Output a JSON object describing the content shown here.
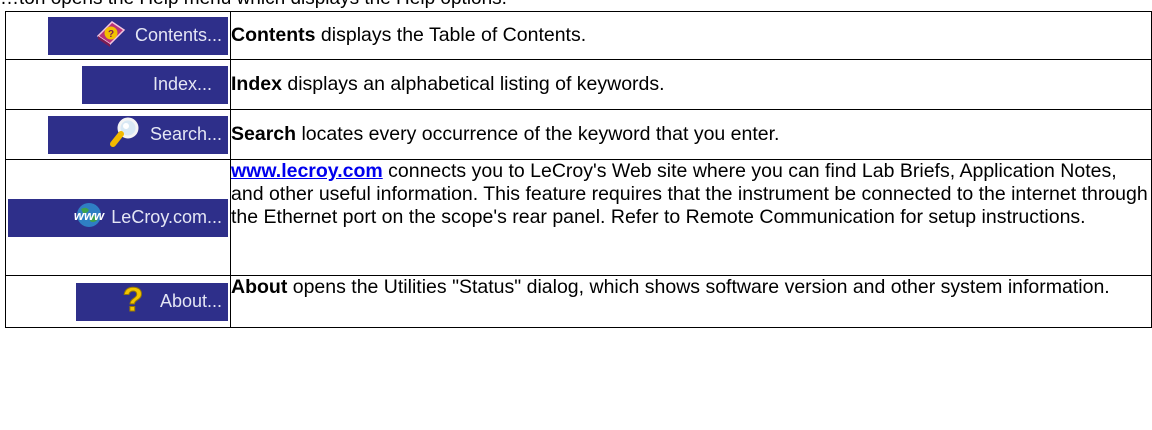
{
  "intro_text": "…ton opens the Help menu which displays the Help options.",
  "rows": [
    {
      "button_label": "Contents...",
      "icon": "book-question-icon",
      "term": "Contents",
      "text": " displays the Table of Contents."
    },
    {
      "button_label": "Index...",
      "icon": "",
      "term": "Index",
      "text": " displays an alphabetical listing of keywords."
    },
    {
      "button_label": "Search...",
      "icon": "magnifier-icon",
      "term": "Search",
      "text": " locates every occurrence of the keyword that you enter."
    },
    {
      "button_label": "LeCroy.com...",
      "icon": "www-globe-icon",
      "term": "www.lecroy.com",
      "text": " connects you to LeCroy's Web site where you can find Lab Briefs, Application Notes, and other useful information. This feature requires that the instrument be connected to the internet through the Ethernet port on the scope's rear panel. Refer to Remote Communication for setup instructions."
    },
    {
      "button_label": "About...",
      "icon": "question-mark-icon",
      "term": "About",
      "text": " opens the Utilities \"Status\" dialog, which shows software version and other system information."
    }
  ],
  "colors": {
    "button_bg": "#2e2f8a",
    "button_text": "#e4e6f4",
    "link": "#0000ee"
  }
}
